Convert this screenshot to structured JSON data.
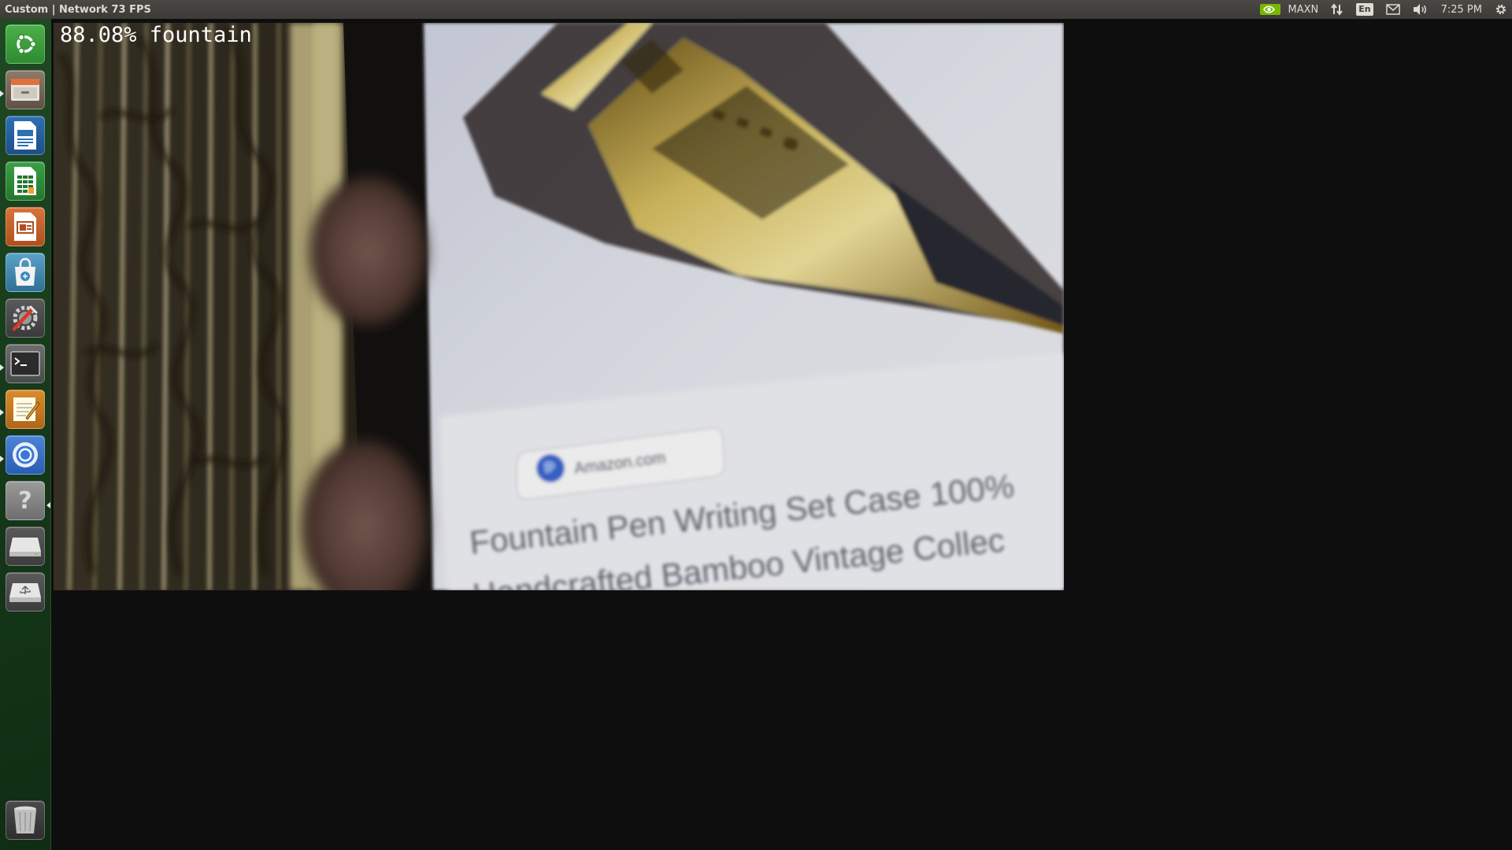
{
  "topbar": {
    "window_title": "Custom | Network 73 FPS",
    "indicators": {
      "nvidia_icon": "nvidia-logo-icon",
      "power_mode": "MAXN",
      "network_icon": "network-transfer-icon",
      "language": "En",
      "mail_icon": "mail-icon",
      "sound_icon": "volume-icon",
      "clock": "7:25 PM",
      "settings_icon": "gear-icon"
    }
  },
  "launcher": {
    "items": [
      {
        "name": "ubuntu-dash",
        "icon": "ubuntu-logo-icon"
      },
      {
        "name": "files",
        "icon": "file-cabinet-icon"
      },
      {
        "name": "libreoffice-writer",
        "icon": "writer-document-icon"
      },
      {
        "name": "libreoffice-calc",
        "icon": "calc-spreadsheet-icon"
      },
      {
        "name": "libreoffice-impress",
        "icon": "impress-presentation-icon"
      },
      {
        "name": "software-center",
        "icon": "shopping-bag-icon"
      },
      {
        "name": "system-settings",
        "icon": "wrench-screwdriver-icon"
      },
      {
        "name": "terminal",
        "icon": "terminal-icon"
      },
      {
        "name": "text-editor",
        "icon": "notepad-pencil-icon"
      },
      {
        "name": "chromium",
        "icon": "chromium-icon"
      },
      {
        "name": "help",
        "icon": "question-mark-icon"
      },
      {
        "name": "drive",
        "icon": "drive-icon"
      },
      {
        "name": "usb-drive",
        "icon": "usb-drive-icon"
      },
      {
        "name": "trash",
        "icon": "trash-icon"
      }
    ]
  },
  "camera": {
    "overlay": "88.08% fountain",
    "scene_text": {
      "source_chip": "Amazon.com",
      "product_line1": "Fountain Pen Writing Set Case 100%",
      "product_line2": "Handcrafted Bamboo Vintage Collec"
    }
  },
  "colors": {
    "panel": "#3c3b37",
    "launcher": "#163a1a",
    "desktop": "#0e0e0e",
    "nvidia_green": "#76b900"
  }
}
